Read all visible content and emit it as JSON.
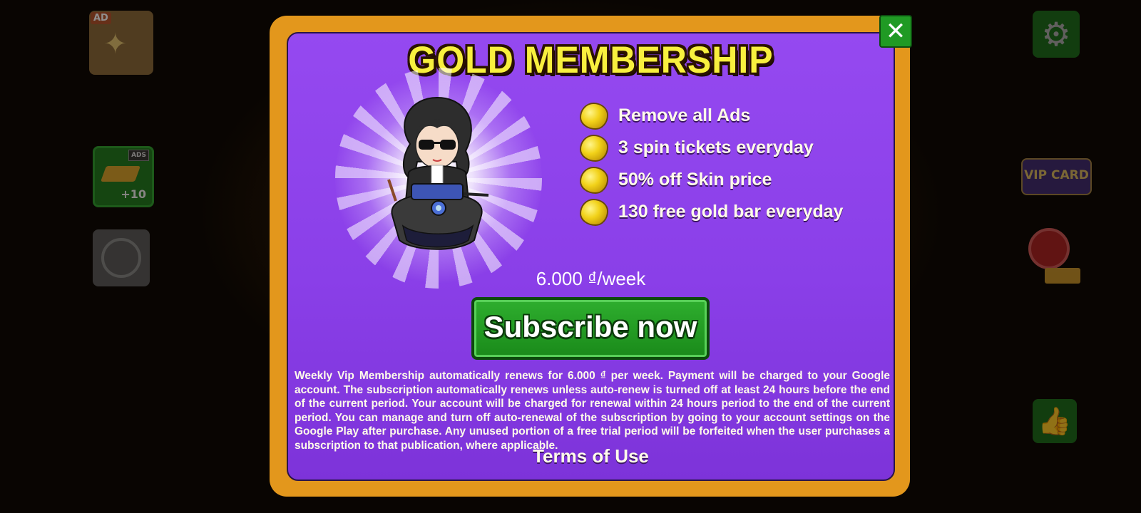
{
  "background": {
    "ad_tile_badge": "AD",
    "goldbar_tile_plus": "+10",
    "goldbar_tile_ad": "ADS",
    "vip_card_label": "VIP CARD",
    "icons": [
      "gear-icon",
      "thumbs-up-icon",
      "alarm-clock-icon",
      "spin-wheel-icon"
    ]
  },
  "modal": {
    "title": "GOLD MEMBERSHIP",
    "close_icon": "close-icon",
    "benefits": [
      {
        "icon": "gold-nugget-icon",
        "text": "Remove all Ads"
      },
      {
        "icon": "gold-nugget-icon",
        "text": "3 spin tickets everyday"
      },
      {
        "icon": "gold-nugget-icon",
        "text": "50% off Skin price"
      },
      {
        "icon": "gold-nugget-icon",
        "text": "130 free gold bar everyday"
      }
    ],
    "price": "6.000 ₫/week",
    "subscribe_label": "Subscribe now",
    "legal_text": "Weekly Vip Membership automatically renews for 6.000 ₫ per week. Payment will be charged to your Google account. The subscription automatically renews unless auto-renew is turned off at least 24 hours before the end of the current period. Your account will be charged for renewal within 24 hours period to the end of the current period. You can manage and turn off auto-renewal of the subscription by going to your account settings on the Google Play after purchase. Any unused portion of a free trial period will be forfeited when the user purchases a subscription to that publication, where applicable.",
    "terms_label": "Terms of Use"
  },
  "colors": {
    "modal_frame": "#e3971c",
    "modal_panel": "#9549f0",
    "title_text": "#f8f03e",
    "subscribe_button": "#1a8a1a",
    "close_button": "#209a24"
  }
}
